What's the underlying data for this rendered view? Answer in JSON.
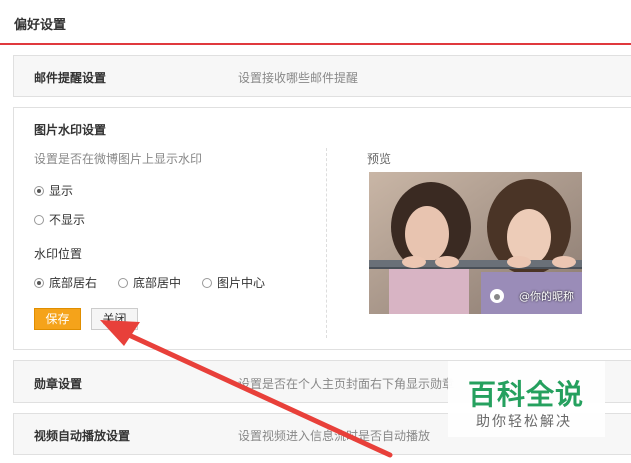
{
  "page": {
    "title": "偏好设置"
  },
  "sections": {
    "email": {
      "title": "邮件提醒设置",
      "desc": "设置接收哪些邮件提醒"
    },
    "watermark": {
      "title": "图片水印设置",
      "desc": "设置是否在微博图片上显示水印",
      "show_label": "显示",
      "hide_label": "不显示",
      "position_title": "水印位置",
      "pos_bottom_right": "底部居右",
      "pos_bottom_center": "底部居中",
      "pos_center": "图片中心",
      "save_label": "保存",
      "close_label": "关闭",
      "preview_label": "预览",
      "watermark_text": "@你的昵称"
    },
    "medal": {
      "title": "勋章设置",
      "desc": "设置是否在个人主页封面右下角显示勋章"
    },
    "video": {
      "title": "视频自动播放设置",
      "desc": "设置视频进入信息流时是否自动播放"
    }
  },
  "brand": {
    "main": "百科全说",
    "sub": "助你轻松解决"
  },
  "colors": {
    "accent": "#e0393e",
    "save": "#f5a31a",
    "arrow": "#e8403a",
    "brand": "#1f9e5a"
  }
}
